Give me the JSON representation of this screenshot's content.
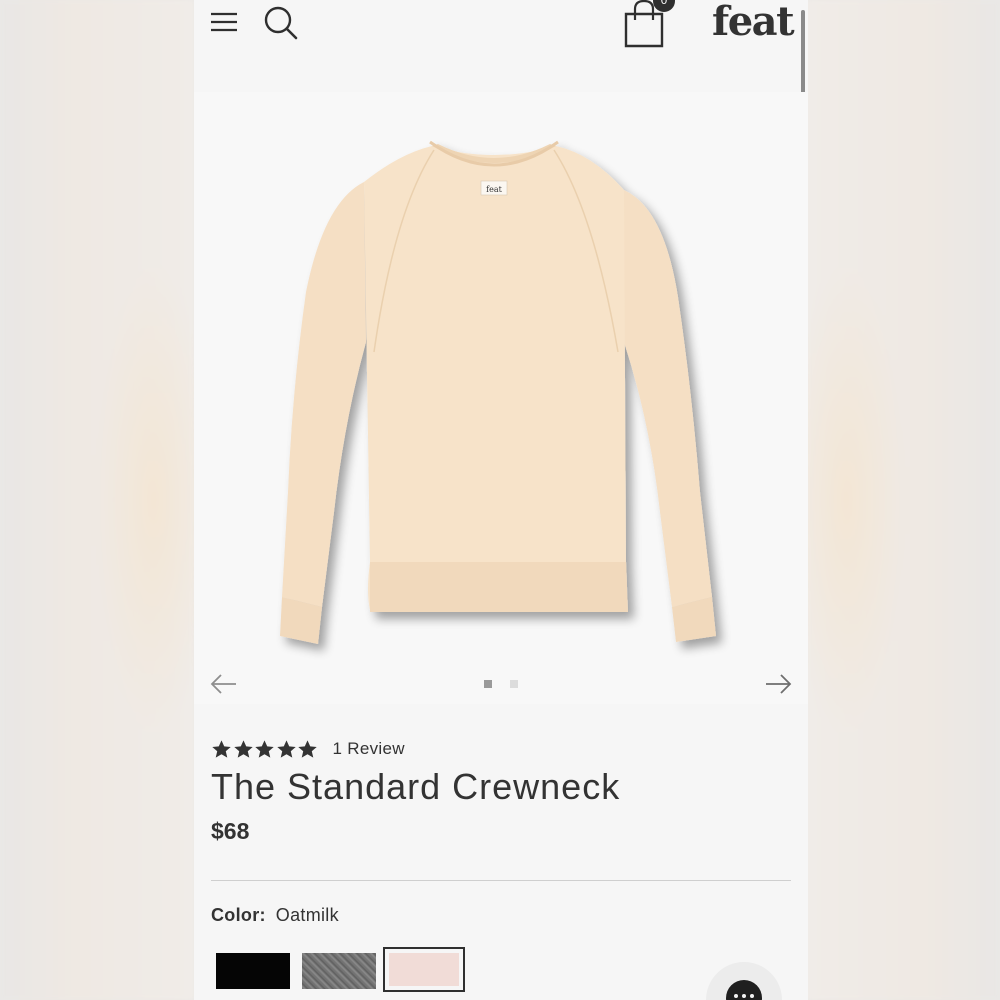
{
  "header": {
    "logo_text": "feat",
    "cart_count": "0"
  },
  "gallery": {
    "total_images": 2,
    "active_index": 1,
    "image_subject": "oatmilk crewneck sweatshirt",
    "garment_label": "feat"
  },
  "product": {
    "rating": 5,
    "max_rating": 5,
    "review_text": "1 Review",
    "title": "The Standard Crewneck",
    "price": "$68"
  },
  "color": {
    "label": "Color:",
    "selected": "Oatmilk",
    "swatches": [
      {
        "name": "black",
        "hex": "#050505"
      },
      {
        "name": "heather gray",
        "hex": "#777777"
      },
      {
        "name": "oatmilk",
        "hex": "#f1dcd7"
      }
    ]
  },
  "colors": {
    "page_bg": "#f6f6f6",
    "text": "#2f2f2f",
    "garment": "#f5dfc4"
  }
}
